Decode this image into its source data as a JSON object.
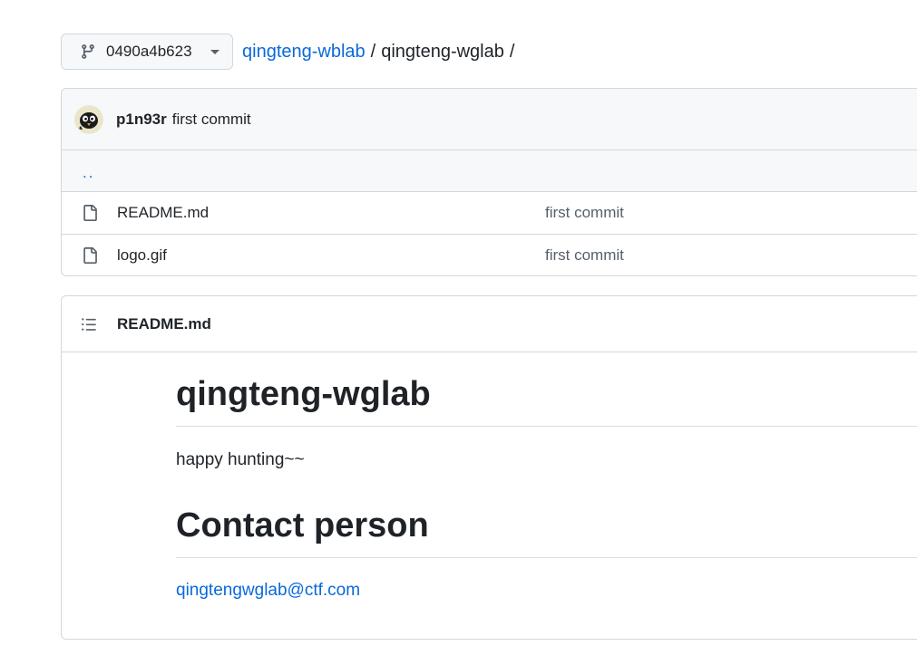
{
  "nav": {
    "branch": "0490a4b623",
    "owner": "qingteng-wblab",
    "separator": "/",
    "repo": "qingteng-wglab",
    "trailing_separator": "/"
  },
  "files": {
    "latest_commit": {
      "author": "p1n93r",
      "message": "first commit"
    },
    "parent_dir": "..",
    "rows": [
      {
        "name": "README.md",
        "commit": "first commit",
        "icon": "file-icon"
      },
      {
        "name": "logo.gif",
        "commit": "first commit",
        "icon": "file-icon"
      }
    ]
  },
  "readme": {
    "filename": "README.md",
    "heading1": "qingteng-wglab",
    "paragraph": "happy hunting~~",
    "heading2": "Contact person",
    "email": "qingtengwglab@ctf.com"
  },
  "colors": {
    "link": "#0969da",
    "border": "#d0d7de",
    "header_bg": "#f6f8fa",
    "text": "#1f2328",
    "muted": "#57606a"
  }
}
